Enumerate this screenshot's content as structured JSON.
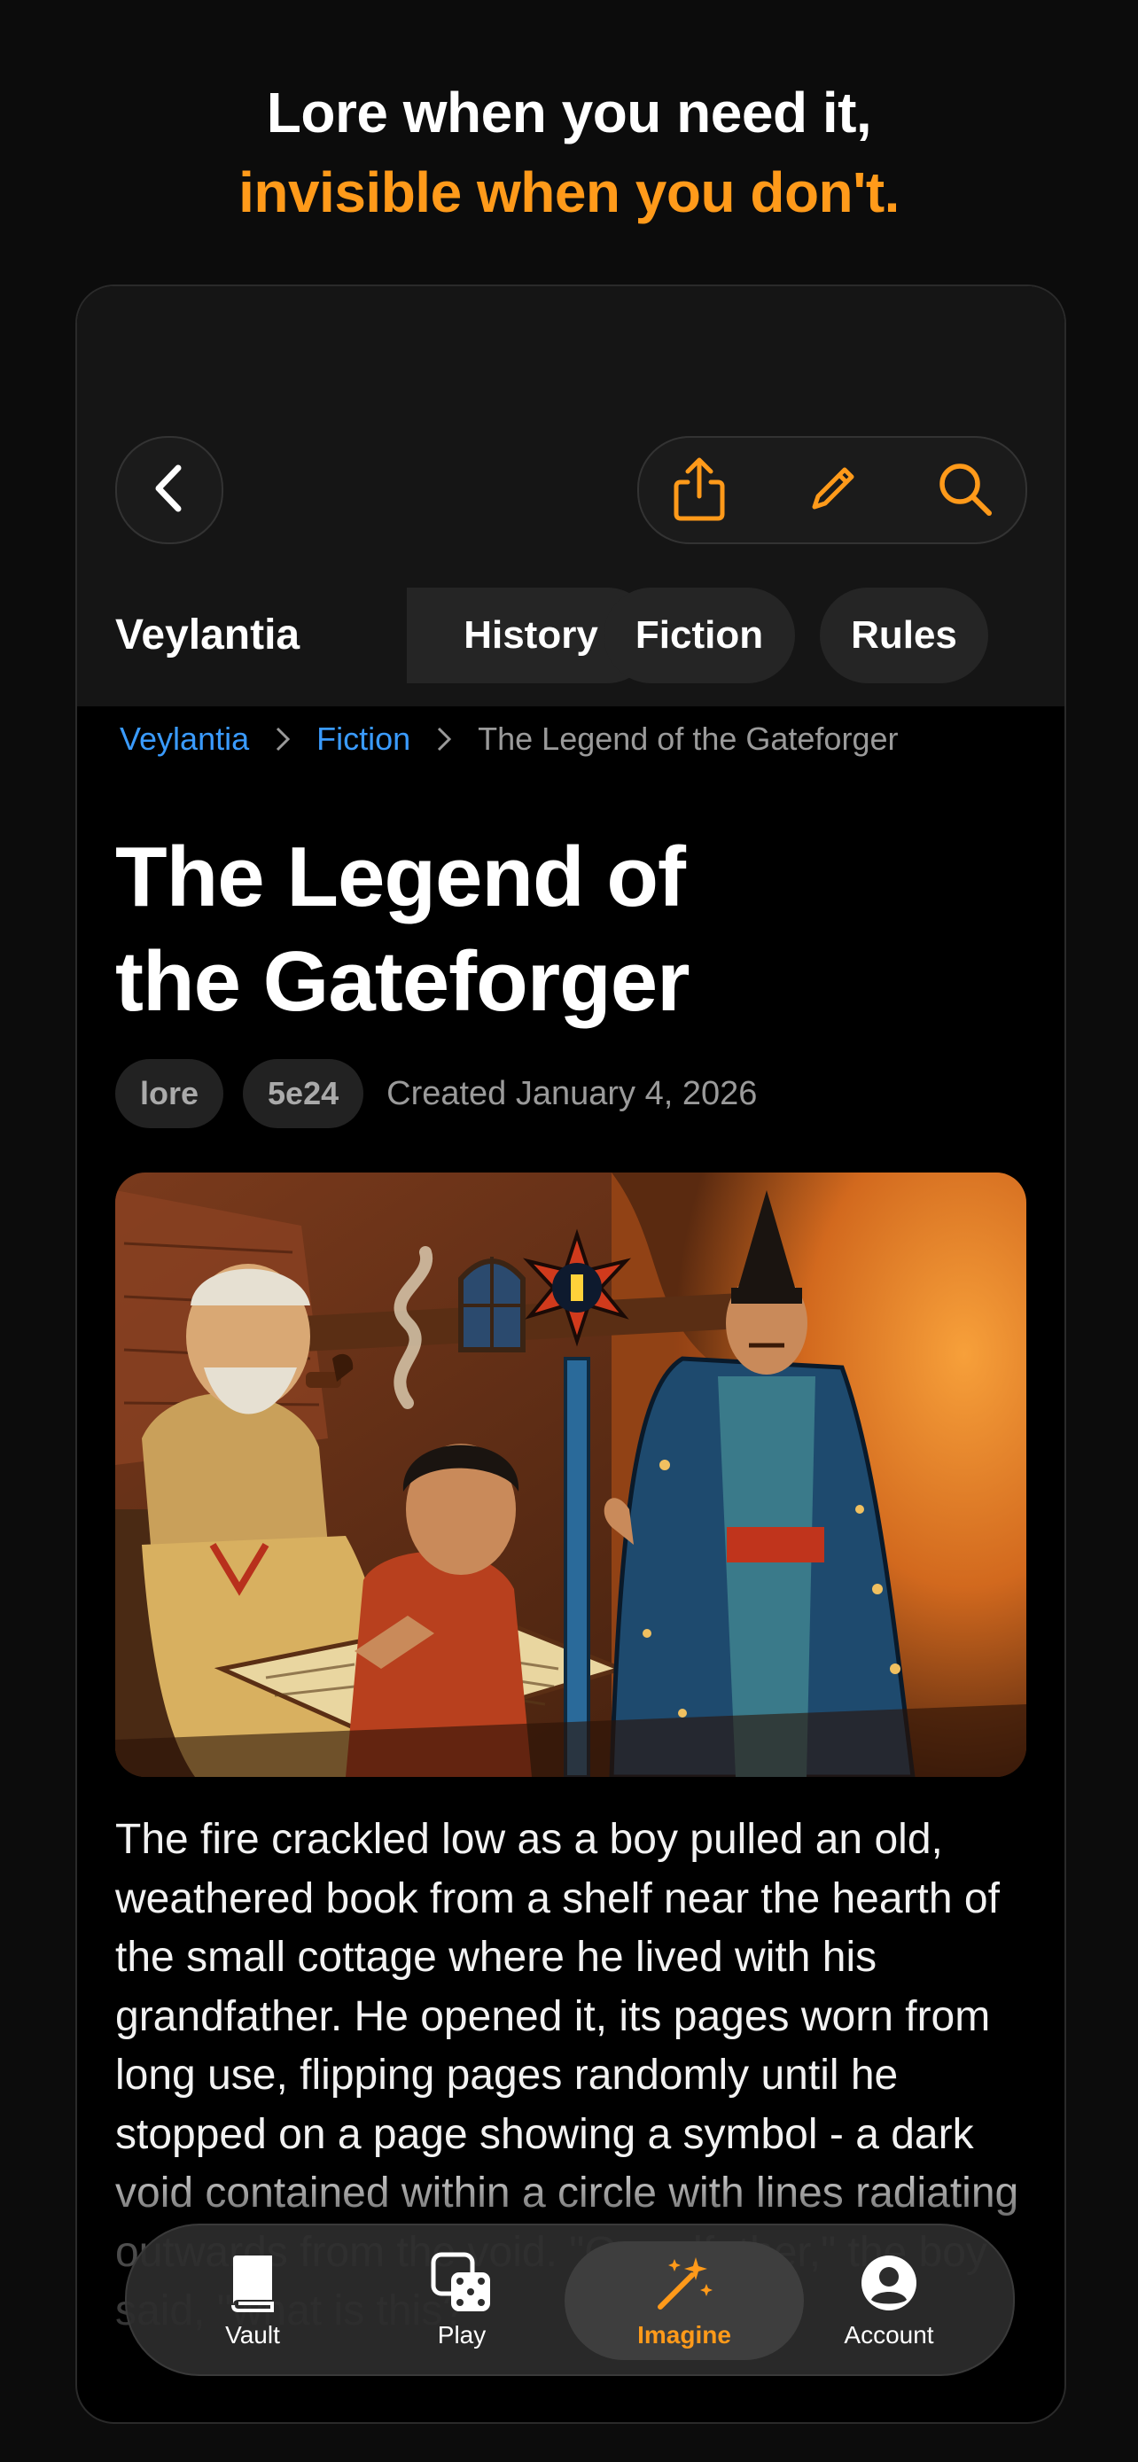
{
  "headline": {
    "line1": "Lore when you need it,",
    "line2": "invisible when you don't."
  },
  "colors": {
    "accent": "#ff9a1a",
    "link": "#3a9bff",
    "background": "#0c0c0c"
  },
  "toolbar": {
    "back_icon": "chevron-left-icon",
    "actions": [
      "share-icon",
      "pencil-icon",
      "search-icon"
    ]
  },
  "space": {
    "title": "Veylantia",
    "tabs": [
      "History",
      "Fiction",
      "Rules"
    ]
  },
  "breadcrumb": {
    "items": [
      "Veylantia",
      "Fiction",
      "The Legend of the Gateforger"
    ]
  },
  "article": {
    "title_line1": "The Legend of",
    "title_line2": "the Gateforger",
    "tags": [
      "lore",
      "5e24"
    ],
    "created": "Created January 4, 2026",
    "body": "The fire crackled low as a boy pulled an old, weathered book from a shelf near the hearth of the small cottage where he lived with his grandfather. He opened it, its pages worn from long use, flipping pages randomly until he stopped on a page showing a symbol - a dark void contained within a circle with lines radiating outwards from the void. \"Grandfather,\" the boy said, \"what is this?\""
  },
  "tabbar": {
    "items": [
      {
        "label": "Vault",
        "icon": "book-icon"
      },
      {
        "label": "Play",
        "icon": "dice-icon"
      },
      {
        "label": "Imagine",
        "icon": "magic-wand-icon"
      },
      {
        "label": "Account",
        "icon": "account-icon"
      }
    ],
    "active": "Imagine"
  }
}
